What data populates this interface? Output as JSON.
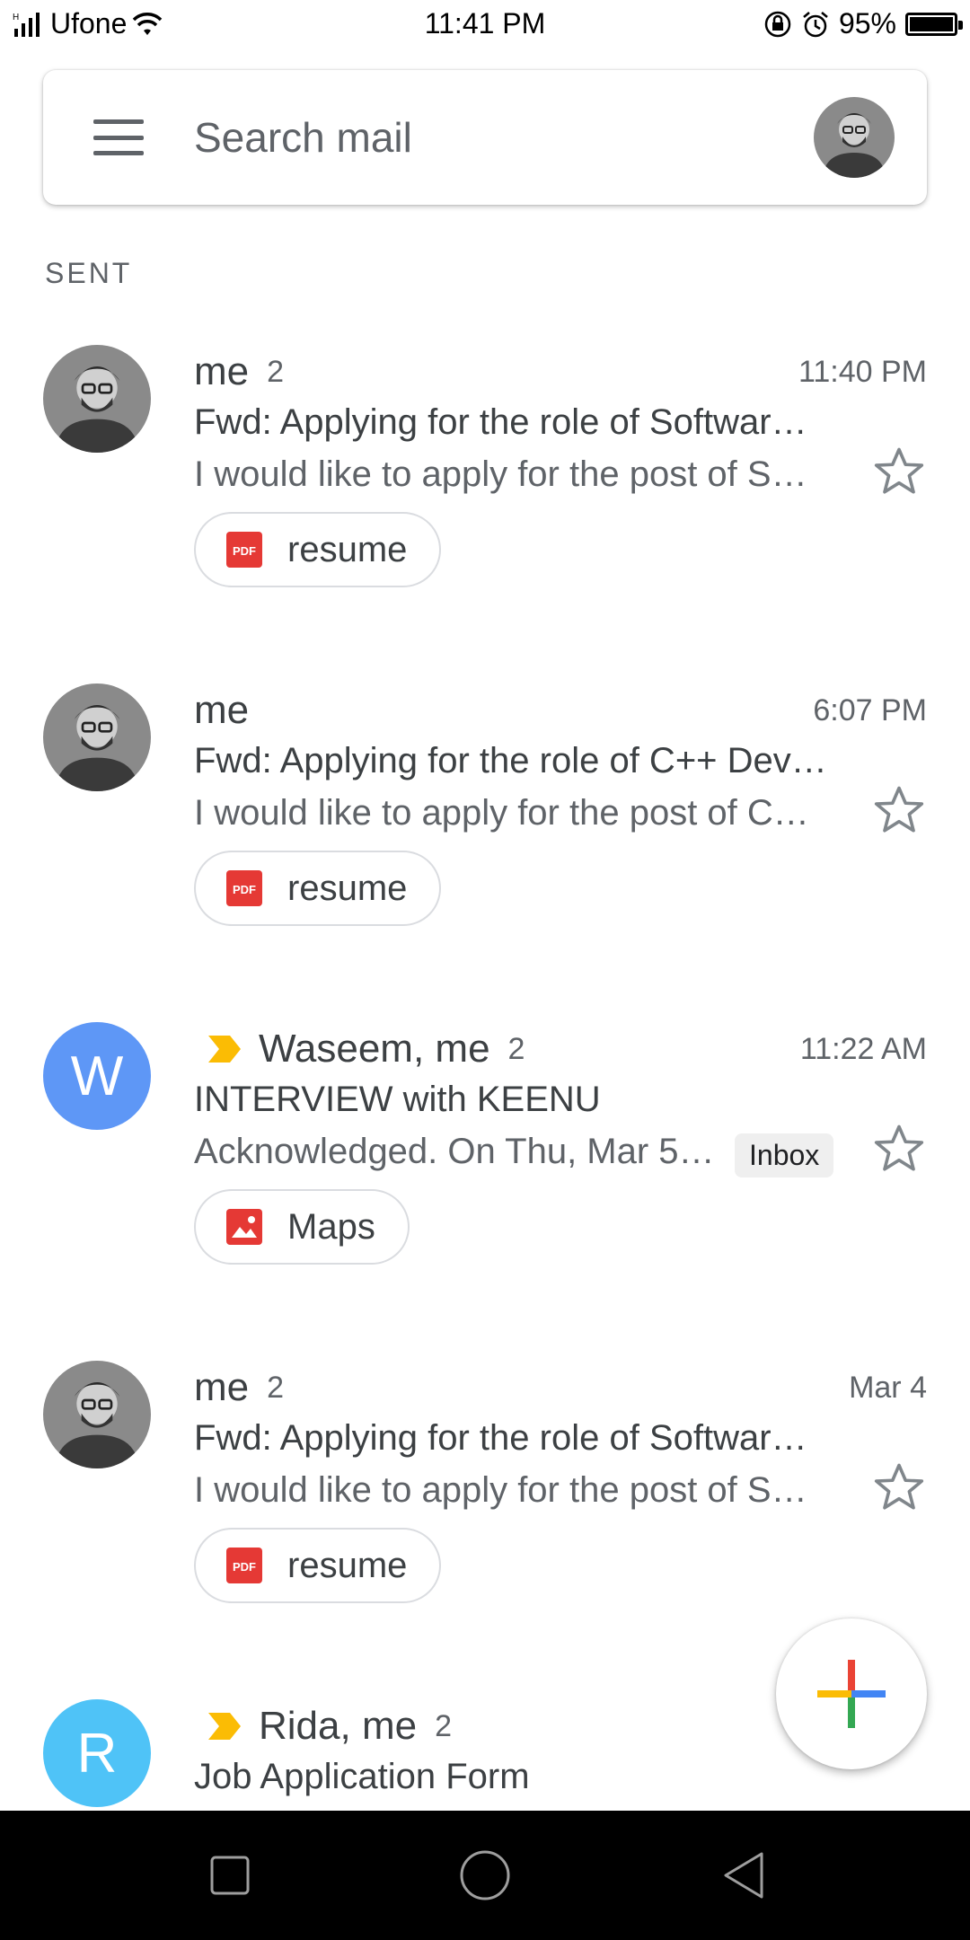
{
  "status_bar": {
    "carrier": "Ufone",
    "network_tag": "H",
    "time": "11:41 PM",
    "battery": "95%",
    "battery_level": 0.95
  },
  "search": {
    "placeholder": "Search mail"
  },
  "section": {
    "title": "SENT"
  },
  "emails": [
    {
      "sender": "me",
      "count": "2",
      "time": "11:40 PM",
      "subject": "Fwd: Applying for the role of Softwar…",
      "snippet": "I would like to apply for the post of S…",
      "attachment": "resume",
      "attachment_icon": "pdf-icon",
      "starred": false,
      "important": false
    },
    {
      "sender": "me",
      "count": "",
      "time": "6:07 PM",
      "subject": "Fwd: Applying for the role of C++ Dev…",
      "snippet": "I would like to apply for the post of C…",
      "attachment": "resume",
      "attachment_icon": "pdf-icon",
      "starred": false,
      "important": false
    },
    {
      "sender": "Waseem, me",
      "avatar_letter": "W",
      "avatar_color": "#5e97f6",
      "count": "2",
      "time": "11:22 AM",
      "subject": "INTERVIEW with KEENU",
      "snippet": "Acknowledged. On Thu, Mar 5…",
      "label": "Inbox",
      "attachment": "Maps",
      "attachment_icon": "image-icon",
      "starred": false,
      "important": true
    },
    {
      "sender": "me",
      "count": "2",
      "time": "Mar 4",
      "subject": "Fwd: Applying for the role of Softwar…",
      "snippet": "I would like to apply for the post of S…",
      "attachment": "resume",
      "attachment_icon": "pdf-icon",
      "starred": false,
      "important": false
    },
    {
      "sender": "Rida, me",
      "avatar_letter": "R",
      "avatar_color": "#4fc3f7",
      "count": "2",
      "subject": "Job Application Form",
      "starred": false,
      "important": true
    }
  ],
  "colors": {
    "importance": "#fbbc04",
    "pdf_red": "#e53935",
    "google_blue": "#4285f4",
    "google_red": "#ea4335",
    "google_yellow": "#fbbc04",
    "google_green": "#34a853"
  },
  "pdf_badge_text": "PDF"
}
